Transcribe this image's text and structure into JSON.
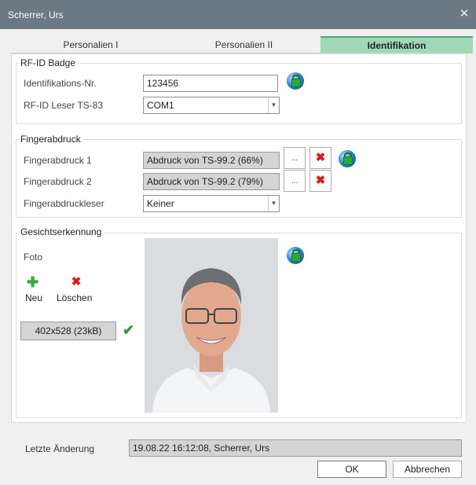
{
  "window": {
    "title": "Scherrer, Urs",
    "close_symbol": "✕"
  },
  "tabs": [
    {
      "label": "Personalien I"
    },
    {
      "label": "Personalien II"
    },
    {
      "label": "Identifikation",
      "active": true
    }
  ],
  "rfid": {
    "group_title": "RF-ID Badge",
    "id_label": "Identifikations-Nr.",
    "id_value": "123456",
    "reader_label": "RF-ID Leser TS-83",
    "reader_value": "COM1"
  },
  "fingerprint": {
    "group_title": "Fingerabdruck",
    "fp1_label": "Fingerabdruck 1",
    "fp1_value": "Abdruck von TS-99.2 (66%)",
    "fp2_label": "Fingerabdruck 2",
    "fp2_value": "Abdruck von TS-99.2 (79%)",
    "reader_label": "Fingerabdruckleser",
    "reader_value": "Keiner",
    "browse_symbol": "..."
  },
  "face": {
    "group_title": "Gesichtserkennung",
    "photo_label": "Foto",
    "new_label": "Neu",
    "delete_label": "Löschen",
    "image_info": "402x528 (23kB)"
  },
  "footer": {
    "last_change_label": "Letzte Änderung",
    "last_change_value": "19.08.22 16:12:08, Scherrer, Urs",
    "ok_label": "OK",
    "cancel_label": "Abbrechen"
  },
  "icons": {
    "globe": "globe-lock-icon",
    "delete": "red-x-icon",
    "add": "green-plus-icon",
    "check": "checkmark-icon",
    "dropdown": "chevron-down-icon"
  },
  "colors": {
    "titlebar": "#6b7985",
    "active_tab": "#9ed8b8",
    "delete": "#e01818",
    "add": "#37a83a"
  }
}
